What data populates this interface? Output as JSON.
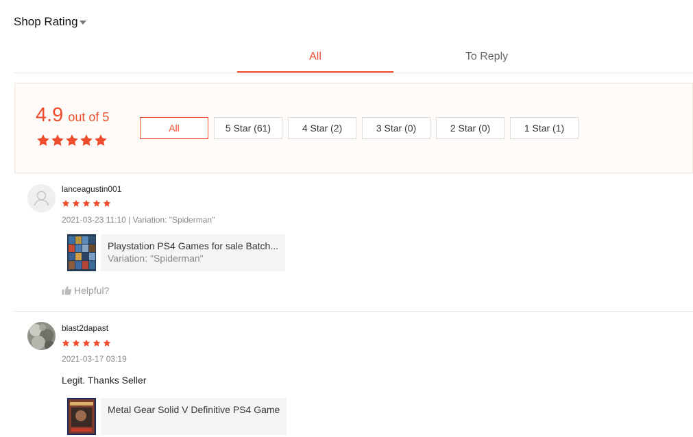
{
  "header": {
    "title": "Shop Rating"
  },
  "tabs": [
    {
      "label": "All"
    },
    {
      "label": "To Reply"
    }
  ],
  "overview": {
    "score": "4.9",
    "suffix": "out of 5",
    "stars": 5,
    "filters": [
      {
        "label": "All"
      },
      {
        "label": "5 Star (61)"
      },
      {
        "label": "4 Star (2)"
      },
      {
        "label": "3 Star (0)"
      },
      {
        "label": "2 Star (0)"
      },
      {
        "label": "1 Star (1)"
      }
    ]
  },
  "reviews": [
    {
      "username": "lanceagustin001",
      "rating": 5,
      "meta": "2021-03-23 11:10 | Variation: \"Spiderman\"",
      "product_name": "Playstation PS4 Games for sale Batch...",
      "product_variation": "Variation: \"Spiderman\"",
      "helpful_label": "Helpful?"
    },
    {
      "username": "blast2dapast",
      "rating": 5,
      "meta": "2021-03-17 03:19",
      "comment": "Legit. Thanks Seller",
      "product_name": "Metal Gear Solid V Definitive PS4 Game"
    }
  ],
  "colors": {
    "accent": "#ee4d2d",
    "star": "#ee4d2d"
  }
}
